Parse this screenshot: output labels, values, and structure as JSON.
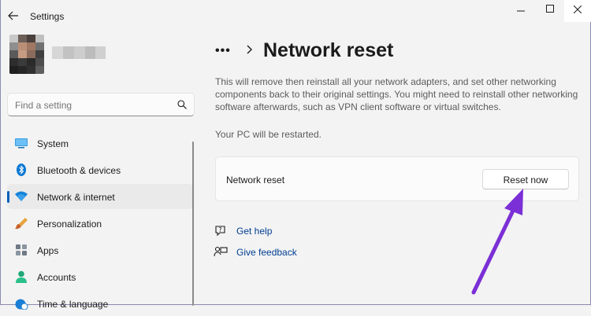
{
  "window": {
    "title": "Settings",
    "back_icon": "back-arrow-icon",
    "controls": [
      "minimize-icon",
      "maximize-icon",
      "close-icon"
    ]
  },
  "search": {
    "placeholder": "Find a setting",
    "icon": "search-icon"
  },
  "sidebar": {
    "items": [
      {
        "label": "System",
        "icon": "system-display-icon",
        "active": false
      },
      {
        "label": "Bluetooth & devices",
        "icon": "bluetooth-icon",
        "active": false
      },
      {
        "label": "Network & internet",
        "icon": "wifi-icon",
        "active": true
      },
      {
        "label": "Personalization",
        "icon": "brush-icon",
        "active": false
      },
      {
        "label": "Apps",
        "icon": "apps-grid-icon",
        "active": false
      },
      {
        "label": "Accounts",
        "icon": "person-icon",
        "active": false
      },
      {
        "label": "Time & language",
        "icon": "globe-clock-icon",
        "active": false
      }
    ]
  },
  "breadcrumb": {
    "overflow": "•••",
    "title": "Network reset"
  },
  "main": {
    "description": "This will remove then reinstall all your network adapters, and set other networking components back to their original settings. You might need to reinstall other networking software afterwards, such as VPN client software or virtual switches.",
    "restart_note": "Your PC will be restarted.",
    "card": {
      "label": "Network reset",
      "button_label": "Reset now"
    },
    "links": [
      {
        "label": "Get help",
        "icon": "help-icon"
      },
      {
        "label": "Give feedback",
        "icon": "feedback-icon"
      }
    ]
  },
  "colors": {
    "accent": "#005fb8",
    "link": "#003e92",
    "annotation_arrow": "#7b2fd6"
  }
}
